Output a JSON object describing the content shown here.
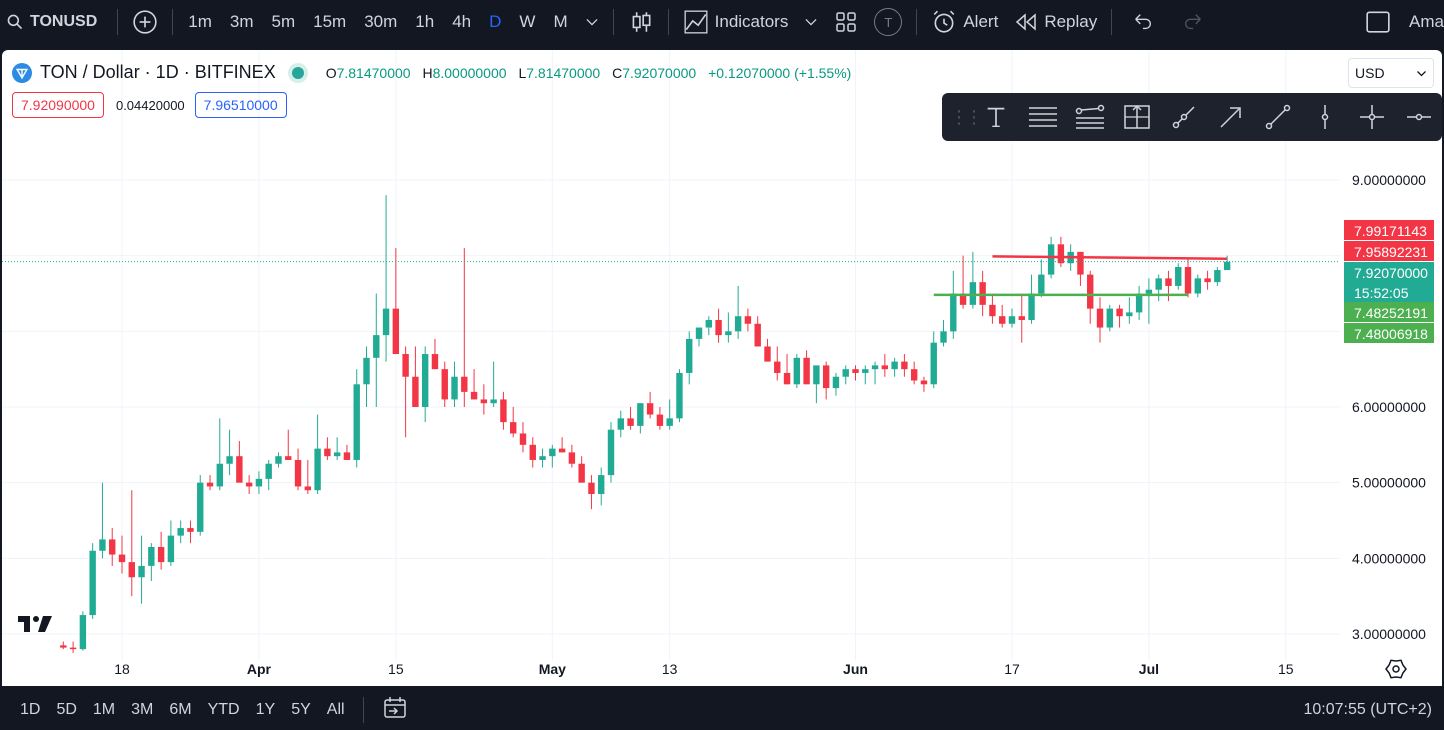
{
  "topbar": {
    "symbol": "TONUSD",
    "intervals": [
      "1m",
      "3m",
      "5m",
      "15m",
      "30m",
      "1h",
      "4h",
      "D",
      "W",
      "M"
    ],
    "active_interval": "D",
    "indicators_label": "Indicators",
    "templates_letter": "T",
    "alert_label": "Alert",
    "replay_label": "Replay",
    "account_label": "Ama"
  },
  "legend": {
    "title": "TON / Dollar · 1D · BITFINEX",
    "o_key": "O",
    "o_val": "7.81470000",
    "h_key": "H",
    "h_val": "8.00000000",
    "l_key": "L",
    "l_val": "7.81470000",
    "c_key": "C",
    "c_val": "7.92070000",
    "change": "+0.12070000 (+1.55%)",
    "sell_price": "7.92090000",
    "spread": "0.04420000",
    "buy_price": "7.96510000"
  },
  "currency": "USD",
  "price_labels": {
    "red_top": "7.99171143",
    "red_bottom": "7.95892231",
    "last": "7.92070000",
    "countdown": "15:52:05",
    "green_top": "7.48252191",
    "green_bottom": "7.48006918"
  },
  "bottombar": {
    "ranges": [
      "1D",
      "5D",
      "1M",
      "3M",
      "6M",
      "YTD",
      "1Y",
      "5Y",
      "All"
    ],
    "clock": "10:07:55 (UTC+2)"
  },
  "colors": {
    "up": "#22ab94",
    "down": "#f23645",
    "bg": "#131722",
    "accent": "#2962ff",
    "support": "#4caf50"
  },
  "chart_data": {
    "type": "candlestick",
    "title": "TON / Dollar · 1D · BITFINEX",
    "ylim": [
      2.7,
      9.8
    ],
    "y_ticks": [
      "3.00000000",
      "4.00000000",
      "5.00000000",
      "6.00000000",
      "9.00000000"
    ],
    "x_ticks": [
      "18",
      "Apr",
      "15",
      "May",
      "13",
      "Jun",
      "17",
      "Jul",
      "15"
    ],
    "x_tick_days": [
      17,
      31,
      45,
      61,
      73,
      92,
      108,
      122,
      136
    ],
    "start_day": 11,
    "last_price": 7.9207,
    "resistance_line": {
      "from_day": 106,
      "to_day": 130,
      "from_price": 7.99,
      "to_price": 7.96
    },
    "support_line": {
      "from_day": 100,
      "to_day": 126,
      "price": 7.482
    },
    "candles": [
      [
        2.85,
        2.9,
        2.8,
        2.82
      ],
      [
        2.82,
        2.9,
        2.75,
        2.8
      ],
      [
        2.8,
        3.3,
        2.78,
        3.25
      ],
      [
        3.25,
        4.2,
        3.2,
        4.1
      ],
      [
        4.1,
        5.0,
        4.0,
        4.25
      ],
      [
        4.25,
        4.4,
        3.9,
        4.05
      ],
      [
        4.05,
        4.3,
        3.8,
        3.95
      ],
      [
        3.95,
        4.9,
        3.5,
        3.75
      ],
      [
        3.75,
        4.3,
        3.4,
        3.9
      ],
      [
        3.9,
        4.2,
        3.7,
        4.15
      ],
      [
        4.15,
        4.35,
        3.85,
        3.95
      ],
      [
        3.95,
        4.5,
        3.9,
        4.3
      ],
      [
        4.3,
        4.5,
        4.2,
        4.4
      ],
      [
        4.4,
        4.5,
        4.2,
        4.35
      ],
      [
        4.35,
        5.1,
        4.3,
        5.0
      ],
      [
        5.0,
        5.1,
        4.9,
        4.95
      ],
      [
        4.95,
        5.85,
        4.9,
        5.25
      ],
      [
        5.25,
        5.7,
        5.1,
        5.35
      ],
      [
        5.35,
        5.55,
        5.1,
        5.0
      ],
      [
        5.0,
        5.1,
        4.85,
        4.95
      ],
      [
        4.95,
        5.15,
        4.85,
        5.05
      ],
      [
        5.05,
        5.3,
        4.9,
        5.25
      ],
      [
        5.25,
        5.4,
        5.2,
        5.35
      ],
      [
        5.35,
        5.7,
        5.3,
        5.3
      ],
      [
        5.3,
        5.45,
        4.9,
        4.95
      ],
      [
        4.95,
        5.3,
        4.85,
        4.9
      ],
      [
        4.9,
        5.9,
        4.85,
        5.45
      ],
      [
        5.45,
        5.6,
        5.3,
        5.35
      ],
      [
        5.35,
        5.6,
        5.3,
        5.4
      ],
      [
        5.4,
        5.5,
        5.3,
        5.3
      ],
      [
        5.3,
        6.5,
        5.2,
        6.3
      ],
      [
        6.3,
        6.8,
        6.0,
        6.65
      ],
      [
        6.65,
        7.5,
        6.0,
        6.95
      ],
      [
        6.95,
        8.8,
        6.6,
        7.3
      ],
      [
        7.3,
        8.1,
        6.9,
        6.7
      ],
      [
        6.7,
        6.8,
        5.6,
        6.4
      ],
      [
        6.4,
        6.8,
        6.0,
        6.0
      ],
      [
        6.0,
        6.8,
        5.8,
        6.7
      ],
      [
        6.7,
        6.9,
        6.5,
        6.5
      ],
      [
        6.5,
        6.6,
        6.0,
        6.1
      ],
      [
        6.1,
        6.6,
        6.0,
        6.4
      ],
      [
        6.4,
        8.1,
        6.0,
        6.2
      ],
      [
        6.2,
        6.5,
        6.1,
        6.1
      ],
      [
        6.1,
        6.3,
        5.9,
        6.05
      ],
      [
        6.05,
        6.6,
        6.0,
        6.1
      ],
      [
        6.1,
        6.2,
        5.7,
        5.8
      ],
      [
        5.8,
        6.0,
        5.6,
        5.65
      ],
      [
        5.65,
        5.8,
        5.4,
        5.5
      ],
      [
        5.5,
        5.6,
        5.2,
        5.3
      ],
      [
        5.3,
        5.45,
        5.2,
        5.35
      ],
      [
        5.35,
        5.5,
        5.2,
        5.45
      ],
      [
        5.45,
        5.6,
        5.4,
        5.4
      ],
      [
        5.4,
        5.5,
        5.2,
        5.25
      ],
      [
        5.25,
        5.35,
        5.0,
        5.0
      ],
      [
        5.0,
        5.1,
        4.65,
        4.85
      ],
      [
        4.85,
        5.2,
        4.7,
        5.1
      ],
      [
        5.1,
        5.8,
        5.0,
        5.7
      ],
      [
        5.7,
        5.95,
        5.6,
        5.85
      ],
      [
        5.85,
        6.0,
        5.7,
        5.75
      ],
      [
        5.75,
        6.05,
        5.65,
        6.05
      ],
      [
        6.05,
        6.2,
        5.85,
        5.9
      ],
      [
        5.9,
        6.0,
        5.7,
        5.75
      ],
      [
        5.75,
        6.1,
        5.7,
        5.85
      ],
      [
        5.85,
        6.5,
        5.8,
        6.45
      ],
      [
        6.45,
        7.0,
        6.3,
        6.9
      ],
      [
        6.9,
        7.05,
        6.8,
        7.05
      ],
      [
        7.05,
        7.2,
        6.95,
        7.15
      ],
      [
        7.15,
        7.3,
        6.85,
        6.95
      ],
      [
        6.95,
        7.25,
        6.85,
        7.0
      ],
      [
        7.0,
        7.6,
        6.9,
        7.2
      ],
      [
        7.2,
        7.3,
        7.0,
        7.1
      ],
      [
        7.1,
        7.2,
        6.85,
        6.8
      ],
      [
        6.8,
        6.9,
        6.6,
        6.6
      ],
      [
        6.6,
        6.8,
        6.35,
        6.45
      ],
      [
        6.45,
        6.7,
        6.3,
        6.3
      ],
      [
        6.3,
        6.7,
        6.25,
        6.65
      ],
      [
        6.65,
        6.75,
        6.3,
        6.3
      ],
      [
        6.3,
        6.5,
        6.05,
        6.55
      ],
      [
        6.55,
        6.6,
        6.1,
        6.25
      ],
      [
        6.25,
        6.45,
        6.15,
        6.4
      ],
      [
        6.4,
        6.55,
        6.3,
        6.5
      ],
      [
        6.5,
        6.55,
        6.35,
        6.45
      ],
      [
        6.45,
        6.55,
        6.3,
        6.5
      ],
      [
        6.5,
        6.6,
        6.3,
        6.55
      ],
      [
        6.55,
        6.7,
        6.4,
        6.5
      ],
      [
        6.5,
        6.65,
        6.4,
        6.6
      ],
      [
        6.6,
        6.7,
        6.4,
        6.5
      ],
      [
        6.5,
        6.6,
        6.3,
        6.35
      ],
      [
        6.35,
        6.4,
        6.2,
        6.3
      ],
      [
        6.3,
        7.0,
        6.25,
        6.85
      ],
      [
        6.85,
        7.15,
        6.8,
        7.0
      ],
      [
        7.0,
        7.8,
        6.9,
        7.5
      ],
      [
        7.5,
        8.0,
        7.3,
        7.35
      ],
      [
        7.35,
        8.05,
        7.3,
        7.65
      ],
      [
        7.65,
        7.8,
        7.2,
        7.35
      ],
      [
        7.35,
        7.5,
        7.1,
        7.2
      ],
      [
        7.2,
        7.35,
        7.05,
        7.1
      ],
      [
        7.1,
        7.3,
        7.05,
        7.2
      ],
      [
        7.2,
        7.5,
        6.85,
        7.15
      ],
      [
        7.15,
        7.75,
        7.1,
        7.5
      ],
      [
        7.5,
        7.95,
        7.45,
        7.75
      ],
      [
        7.75,
        8.25,
        7.7,
        8.15
      ],
      [
        8.15,
        8.25,
        7.85,
        7.9
      ],
      [
        7.9,
        8.15,
        7.8,
        8.05
      ],
      [
        8.05,
        8.05,
        7.6,
        7.75
      ],
      [
        7.75,
        7.8,
        7.1,
        7.3
      ],
      [
        7.3,
        7.45,
        6.85,
        7.05
      ],
      [
        7.05,
        7.35,
        7.0,
        7.3
      ],
      [
        7.3,
        7.35,
        7.05,
        7.2
      ],
      [
        7.2,
        7.45,
        7.1,
        7.25
      ],
      [
        7.25,
        7.6,
        7.15,
        7.5
      ],
      [
        7.5,
        7.7,
        7.1,
        7.55
      ],
      [
        7.55,
        7.75,
        7.4,
        7.7
      ],
      [
        7.7,
        7.8,
        7.4,
        7.6
      ],
      [
        7.6,
        7.9,
        7.55,
        7.85
      ],
      [
        7.85,
        7.95,
        7.45,
        7.5
      ],
      [
        7.5,
        7.75,
        7.45,
        7.7
      ],
      [
        7.7,
        7.8,
        7.55,
        7.65
      ],
      [
        7.65,
        7.85,
        7.6,
        7.81
      ],
      [
        7.81,
        8.0,
        7.81,
        7.92
      ]
    ]
  }
}
